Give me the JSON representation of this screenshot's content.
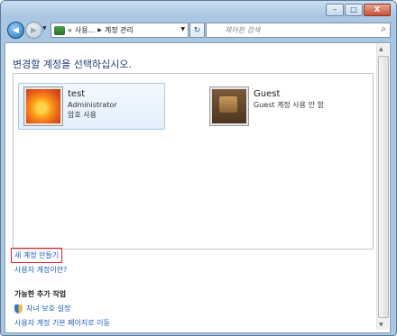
{
  "window": {
    "title_buttons": {
      "minimize": "–",
      "maximize": "□",
      "close": "X"
    }
  },
  "nav": {
    "back_icon": "◀",
    "forward_icon": "▶",
    "dropdown_icon": "▼",
    "breadcrumb": [
      "«",
      "사용...",
      "계정 관리"
    ],
    "breadcrumb_sep": "▶",
    "address_dropdown": "▼",
    "refresh_icon": "↻",
    "search_placeholder": "제어판 검색",
    "search_icon": "⌕"
  },
  "main": {
    "heading": "변경할 계정을 선택하십시오.",
    "accounts": [
      {
        "name": "test",
        "line1": "Administrator",
        "line2": "암호 사용",
        "icon": "flower-icon"
      },
      {
        "name": "Guest",
        "line1": "Guest 계정 사용 안 함",
        "line2": "",
        "icon": "briefcase-icon"
      }
    ],
    "create_account_link": "새 계정 만들기",
    "what_is_account_link": "사용자 계정이란?",
    "additional_tasks_title": "가능한 추가 작업",
    "parental_controls_link": "자녀 보호 설정",
    "homepage_link": "사용자 계정 기본 페이지로 이동"
  },
  "scrollbar": {
    "up": "▲",
    "down": "▼"
  },
  "colors": {
    "heading": "#1e3f7d",
    "link": "#1e5ebf",
    "highlight_box": "#e32020",
    "selected_bg": "#e3f0fc",
    "frame": "#a9c6e2"
  }
}
